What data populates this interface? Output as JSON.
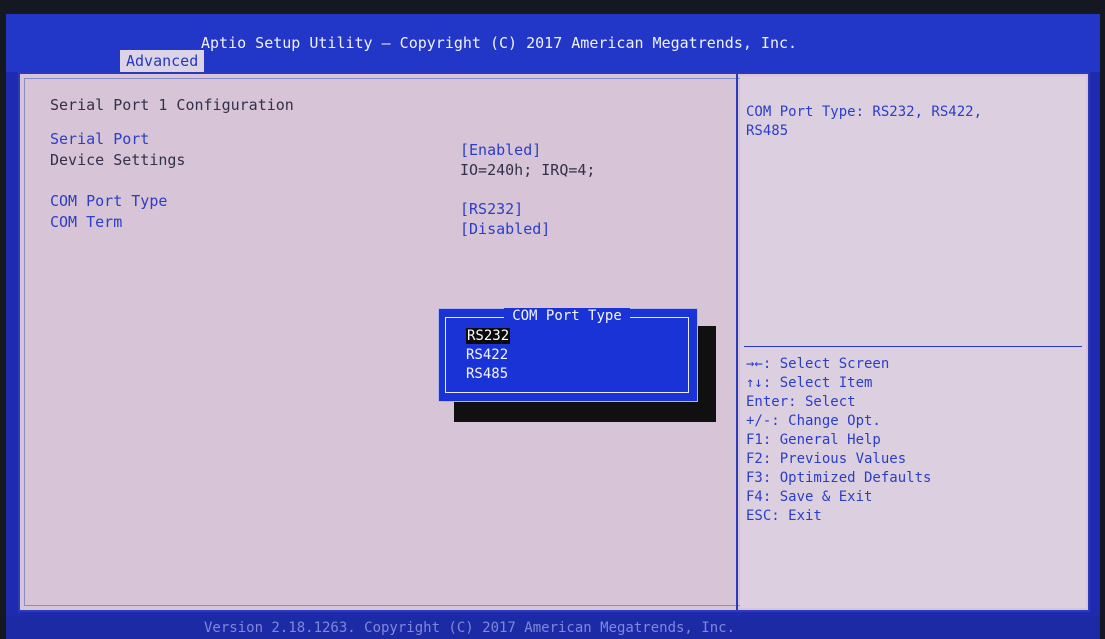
{
  "header": {
    "title": "Aptio Setup Utility – Copyright (C) 2017 American Megatrends, Inc.",
    "tab": "Advanced"
  },
  "main": {
    "section_title": "Serial Port 1 Configuration",
    "settings": [
      {
        "label": "Serial Port",
        "value": "[Enabled]"
      },
      {
        "label": "Device Settings",
        "value": "IO=240h; IRQ=4;"
      },
      {
        "label": "COM Port Type",
        "value": "[RS232]"
      },
      {
        "label": "COM Term",
        "value": "[Disabled]"
      }
    ]
  },
  "popup": {
    "title": "COM Port Type",
    "options": [
      "RS232",
      "RS422",
      "RS485"
    ],
    "selected": "RS232"
  },
  "help": {
    "description_line1": "COM Port Type: RS232, RS422,",
    "description_line2": "RS485",
    "keys": [
      "→←: Select Screen",
      "↑↓: Select Item",
      "Enter: Select",
      "+/-: Change Opt.",
      "F1: General Help",
      "F2: Previous Values",
      "F3: Optimized Defaults",
      "F4: Save & Exit",
      "ESC: Exit"
    ]
  },
  "footer": {
    "text": "Version 2.18.1263. Copyright (C) 2017 American Megatrends, Inc."
  },
  "colors": {
    "bios_blue": "#2236c8",
    "panel_bg": "#d7c4d6",
    "popup_bg": "#1a33d6",
    "selected_bg": "#0a0a0a"
  }
}
